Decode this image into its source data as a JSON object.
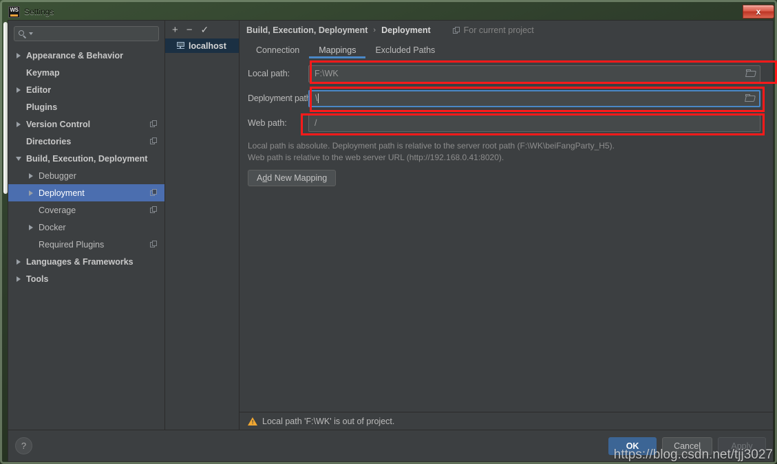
{
  "window": {
    "title": "Settings",
    "app_icon": "webstorm-icon",
    "close_label": "x"
  },
  "sidebar": {
    "search": {
      "value": "",
      "placeholder": ""
    },
    "items": [
      {
        "label": "Appearance & Behavior",
        "arrow": "right",
        "indent": 0,
        "bold": true,
        "badge": false,
        "selected": false
      },
      {
        "label": "Keymap",
        "arrow": "none",
        "indent": 0,
        "bold": true,
        "badge": false,
        "selected": false
      },
      {
        "label": "Editor",
        "arrow": "right",
        "indent": 0,
        "bold": true,
        "badge": false,
        "selected": false
      },
      {
        "label": "Plugins",
        "arrow": "none",
        "indent": 0,
        "bold": true,
        "badge": false,
        "selected": false
      },
      {
        "label": "Version Control",
        "arrow": "right",
        "indent": 0,
        "bold": true,
        "badge": true,
        "selected": false
      },
      {
        "label": "Directories",
        "arrow": "none",
        "indent": 0,
        "bold": true,
        "badge": true,
        "selected": false
      },
      {
        "label": "Build, Execution, Deployment",
        "arrow": "down",
        "indent": 0,
        "bold": true,
        "badge": false,
        "selected": false
      },
      {
        "label": "Debugger",
        "arrow": "right",
        "indent": 1,
        "bold": false,
        "badge": false,
        "selected": false
      },
      {
        "label": "Deployment",
        "arrow": "right",
        "indent": 1,
        "bold": false,
        "badge": true,
        "selected": true
      },
      {
        "label": "Coverage",
        "arrow": "none",
        "indent": 1,
        "bold": false,
        "badge": true,
        "selected": false
      },
      {
        "label": "Docker",
        "arrow": "right",
        "indent": 1,
        "bold": false,
        "badge": false,
        "selected": false
      },
      {
        "label": "Required Plugins",
        "arrow": "none",
        "indent": 1,
        "bold": false,
        "badge": true,
        "selected": false
      },
      {
        "label": "Languages & Frameworks",
        "arrow": "right",
        "indent": 0,
        "bold": true,
        "badge": false,
        "selected": false
      },
      {
        "label": "Tools",
        "arrow": "right",
        "indent": 0,
        "bold": true,
        "badge": false,
        "selected": false
      }
    ]
  },
  "servers": {
    "toolbar": {
      "add": "+",
      "remove": "−",
      "default": "✓"
    },
    "items": [
      {
        "label": "localhost",
        "icon": "server-icon",
        "selected": true
      }
    ]
  },
  "breadcrumb": {
    "parent": "Build, Execution, Deployment",
    "separator": "›",
    "current": "Deployment",
    "scope_label": "For current project"
  },
  "tabs": [
    {
      "label": "Connection",
      "active": false
    },
    {
      "label": "Mappings",
      "active": true
    },
    {
      "label": "Excluded Paths",
      "active": false
    }
  ],
  "form": {
    "fields": [
      {
        "label": "Local path:",
        "value": "F:\\WK",
        "has_browse": true,
        "focused": false,
        "highlighted": true,
        "caret": false
      },
      {
        "label": "Deployment path:",
        "value": "\\",
        "has_browse": true,
        "focused": true,
        "highlighted": true,
        "caret": true
      },
      {
        "label": "Web path:",
        "value": "/",
        "has_browse": false,
        "focused": false,
        "highlighted": true,
        "caret": false
      }
    ],
    "hint_line1": "Local path is absolute. Deployment path is relative to the server root path (F:\\WK\\beiFangParty_H5).",
    "hint_line2": "Web path is relative to the web server URL (http://192.168.0.41:8020).",
    "add_mapping_prefix": "A",
    "add_mapping_accel": "d",
    "add_mapping_suffix": "d New Mapping"
  },
  "status": {
    "warning_icon": "warning-triangle-icon",
    "warning_text": "Local path 'F:\\WK' is out of project."
  },
  "footer": {
    "help": "?",
    "ok": "OK",
    "cancel": "Cancel",
    "apply": "Apply"
  },
  "overlay": {
    "watermark": "https://blog.csdn.net/tjj3027"
  },
  "colors": {
    "accent_blue": "#4b6eaf",
    "tab_underline": "#4a88c7",
    "annotation_red": "#ff1a1a",
    "warning_orange": "#f0a732",
    "panel_bg": "#3c3f41",
    "field_bg": "#45494a",
    "selection_navy": "#1b3043"
  }
}
